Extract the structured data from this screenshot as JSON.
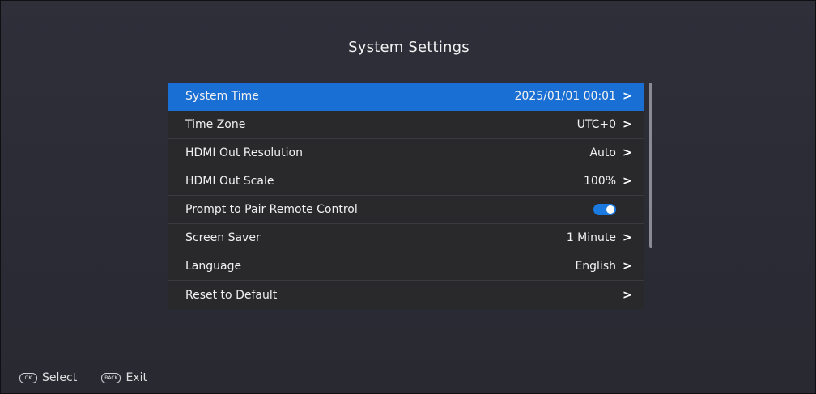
{
  "header": {
    "title": "System Settings"
  },
  "settings": [
    {
      "label": "System Time",
      "value": "2025/01/01 00:01",
      "chevron": ">"
    },
    {
      "label": "Time Zone",
      "value": "UTC+0",
      "chevron": ">"
    },
    {
      "label": "HDMI Out Resolution",
      "value": "Auto",
      "chevron": ">"
    },
    {
      "label": "HDMI Out Scale",
      "value": "100%",
      "chevron": ">"
    },
    {
      "label": "Prompt to Pair Remote Control",
      "toggle": "on"
    },
    {
      "label": "Screen Saver",
      "value": "1 Minute",
      "chevron": ">"
    },
    {
      "label": "Language",
      "value": "English",
      "chevron": ">"
    },
    {
      "label": "Reset to Default",
      "value": "",
      "chevron": ">"
    }
  ],
  "selected_index": 0,
  "footer": {
    "select": {
      "key": "OK",
      "label": "Select"
    },
    "exit": {
      "key": "BACK",
      "label": "Exit"
    }
  },
  "colors": {
    "selected": "#1a6fd4",
    "row": "#29292b",
    "background": "#2c2c36",
    "toggle": "#1a7ae0"
  }
}
